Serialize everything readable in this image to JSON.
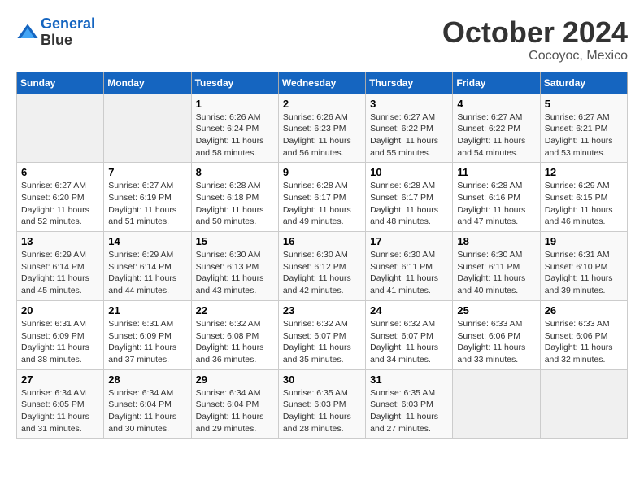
{
  "header": {
    "logo_line1": "General",
    "logo_line2": "Blue",
    "month": "October 2024",
    "location": "Cocoyoc, Mexico"
  },
  "days_of_week": [
    "Sunday",
    "Monday",
    "Tuesday",
    "Wednesday",
    "Thursday",
    "Friday",
    "Saturday"
  ],
  "weeks": [
    [
      {
        "day": "",
        "sunrise": "",
        "sunset": "",
        "daylight": ""
      },
      {
        "day": "",
        "sunrise": "",
        "sunset": "",
        "daylight": ""
      },
      {
        "day": "1",
        "sunrise": "Sunrise: 6:26 AM",
        "sunset": "Sunset: 6:24 PM",
        "daylight": "Daylight: 11 hours and 58 minutes."
      },
      {
        "day": "2",
        "sunrise": "Sunrise: 6:26 AM",
        "sunset": "Sunset: 6:23 PM",
        "daylight": "Daylight: 11 hours and 56 minutes."
      },
      {
        "day": "3",
        "sunrise": "Sunrise: 6:27 AM",
        "sunset": "Sunset: 6:22 PM",
        "daylight": "Daylight: 11 hours and 55 minutes."
      },
      {
        "day": "4",
        "sunrise": "Sunrise: 6:27 AM",
        "sunset": "Sunset: 6:22 PM",
        "daylight": "Daylight: 11 hours and 54 minutes."
      },
      {
        "day": "5",
        "sunrise": "Sunrise: 6:27 AM",
        "sunset": "Sunset: 6:21 PM",
        "daylight": "Daylight: 11 hours and 53 minutes."
      }
    ],
    [
      {
        "day": "6",
        "sunrise": "Sunrise: 6:27 AM",
        "sunset": "Sunset: 6:20 PM",
        "daylight": "Daylight: 11 hours and 52 minutes."
      },
      {
        "day": "7",
        "sunrise": "Sunrise: 6:27 AM",
        "sunset": "Sunset: 6:19 PM",
        "daylight": "Daylight: 11 hours and 51 minutes."
      },
      {
        "day": "8",
        "sunrise": "Sunrise: 6:28 AM",
        "sunset": "Sunset: 6:18 PM",
        "daylight": "Daylight: 11 hours and 50 minutes."
      },
      {
        "day": "9",
        "sunrise": "Sunrise: 6:28 AM",
        "sunset": "Sunset: 6:17 PM",
        "daylight": "Daylight: 11 hours and 49 minutes."
      },
      {
        "day": "10",
        "sunrise": "Sunrise: 6:28 AM",
        "sunset": "Sunset: 6:17 PM",
        "daylight": "Daylight: 11 hours and 48 minutes."
      },
      {
        "day": "11",
        "sunrise": "Sunrise: 6:28 AM",
        "sunset": "Sunset: 6:16 PM",
        "daylight": "Daylight: 11 hours and 47 minutes."
      },
      {
        "day": "12",
        "sunrise": "Sunrise: 6:29 AM",
        "sunset": "Sunset: 6:15 PM",
        "daylight": "Daylight: 11 hours and 46 minutes."
      }
    ],
    [
      {
        "day": "13",
        "sunrise": "Sunrise: 6:29 AM",
        "sunset": "Sunset: 6:14 PM",
        "daylight": "Daylight: 11 hours and 45 minutes."
      },
      {
        "day": "14",
        "sunrise": "Sunrise: 6:29 AM",
        "sunset": "Sunset: 6:14 PM",
        "daylight": "Daylight: 11 hours and 44 minutes."
      },
      {
        "day": "15",
        "sunrise": "Sunrise: 6:30 AM",
        "sunset": "Sunset: 6:13 PM",
        "daylight": "Daylight: 11 hours and 43 minutes."
      },
      {
        "day": "16",
        "sunrise": "Sunrise: 6:30 AM",
        "sunset": "Sunset: 6:12 PM",
        "daylight": "Daylight: 11 hours and 42 minutes."
      },
      {
        "day": "17",
        "sunrise": "Sunrise: 6:30 AM",
        "sunset": "Sunset: 6:11 PM",
        "daylight": "Daylight: 11 hours and 41 minutes."
      },
      {
        "day": "18",
        "sunrise": "Sunrise: 6:30 AM",
        "sunset": "Sunset: 6:11 PM",
        "daylight": "Daylight: 11 hours and 40 minutes."
      },
      {
        "day": "19",
        "sunrise": "Sunrise: 6:31 AM",
        "sunset": "Sunset: 6:10 PM",
        "daylight": "Daylight: 11 hours and 39 minutes."
      }
    ],
    [
      {
        "day": "20",
        "sunrise": "Sunrise: 6:31 AM",
        "sunset": "Sunset: 6:09 PM",
        "daylight": "Daylight: 11 hours and 38 minutes."
      },
      {
        "day": "21",
        "sunrise": "Sunrise: 6:31 AM",
        "sunset": "Sunset: 6:09 PM",
        "daylight": "Daylight: 11 hours and 37 minutes."
      },
      {
        "day": "22",
        "sunrise": "Sunrise: 6:32 AM",
        "sunset": "Sunset: 6:08 PM",
        "daylight": "Daylight: 11 hours and 36 minutes."
      },
      {
        "day": "23",
        "sunrise": "Sunrise: 6:32 AM",
        "sunset": "Sunset: 6:07 PM",
        "daylight": "Daylight: 11 hours and 35 minutes."
      },
      {
        "day": "24",
        "sunrise": "Sunrise: 6:32 AM",
        "sunset": "Sunset: 6:07 PM",
        "daylight": "Daylight: 11 hours and 34 minutes."
      },
      {
        "day": "25",
        "sunrise": "Sunrise: 6:33 AM",
        "sunset": "Sunset: 6:06 PM",
        "daylight": "Daylight: 11 hours and 33 minutes."
      },
      {
        "day": "26",
        "sunrise": "Sunrise: 6:33 AM",
        "sunset": "Sunset: 6:06 PM",
        "daylight": "Daylight: 11 hours and 32 minutes."
      }
    ],
    [
      {
        "day": "27",
        "sunrise": "Sunrise: 6:34 AM",
        "sunset": "Sunset: 6:05 PM",
        "daylight": "Daylight: 11 hours and 31 minutes."
      },
      {
        "day": "28",
        "sunrise": "Sunrise: 6:34 AM",
        "sunset": "Sunset: 6:04 PM",
        "daylight": "Daylight: 11 hours and 30 minutes."
      },
      {
        "day": "29",
        "sunrise": "Sunrise: 6:34 AM",
        "sunset": "Sunset: 6:04 PM",
        "daylight": "Daylight: 11 hours and 29 minutes."
      },
      {
        "day": "30",
        "sunrise": "Sunrise: 6:35 AM",
        "sunset": "Sunset: 6:03 PM",
        "daylight": "Daylight: 11 hours and 28 minutes."
      },
      {
        "day": "31",
        "sunrise": "Sunrise: 6:35 AM",
        "sunset": "Sunset: 6:03 PM",
        "daylight": "Daylight: 11 hours and 27 minutes."
      },
      {
        "day": "",
        "sunrise": "",
        "sunset": "",
        "daylight": ""
      },
      {
        "day": "",
        "sunrise": "",
        "sunset": "",
        "daylight": ""
      }
    ]
  ]
}
